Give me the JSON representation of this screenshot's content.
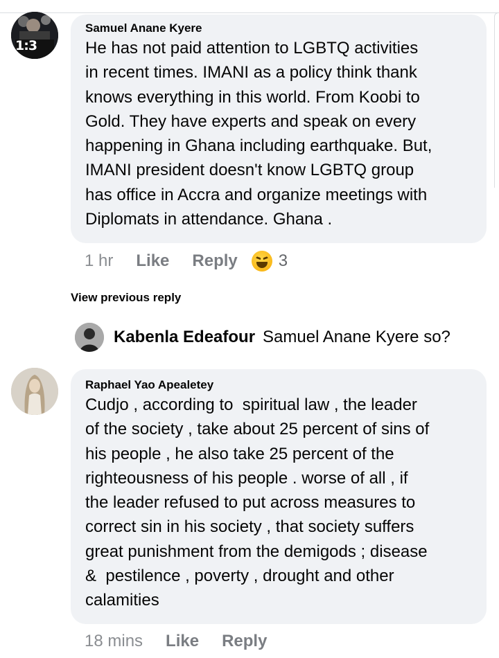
{
  "comments": [
    {
      "author": "Samuel Anane Kyere",
      "avatar_badge": "1:3",
      "text": "He has not paid attention to LGBTQ activities\nin recent times. IMANI as a policy think thank\nknows everything in this world. From Koobi to\nGold. They have experts and speak on every\nhappening in Ghana including earthquake. But,\nIMANI president doesn't know LGBTQ group\nhas office in Accra and organize meetings with\nDiplomats in attendance. Ghana .",
      "time": "1 hr",
      "like_label": "Like",
      "reply_label": "Reply",
      "reaction_icon": "laughing-emoji-icon",
      "reaction_count": "3"
    },
    {
      "author": "Raphael Yao Apealetey",
      "text": "Cudjo , according to  spiritual law , the leader\nof the society , take about 25 percent of sins of\nhis people , he also take 25 percent of the\nrighteousness of his people . worse of all , if\nthe leader refused to put across measures to\ncorrect sin in his society , that society suffers\ngreat punishment from the demigods ; disease\n&  pestilence , poverty , drought and other\ncalamities",
      "time": "18 mins",
      "like_label": "Like",
      "reply_label": "Reply"
    }
  ],
  "view_previous_label": "View previous reply",
  "reply_preview": {
    "author": "Kabenla Edeafour",
    "text": "Samuel Anane Kyere so?"
  },
  "colors": {
    "bubble": "#f0f2f5",
    "meta_text": "#65676b",
    "reaction": "#f9b616"
  }
}
